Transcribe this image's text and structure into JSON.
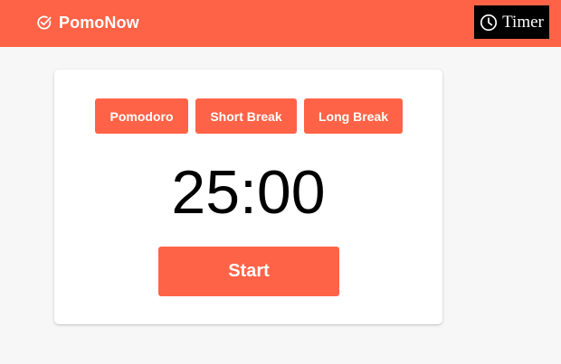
{
  "header": {
    "brand_icon": "check-circle-icon",
    "brand_name": "PomoNow",
    "timer_icon": "clock-icon",
    "timer_label": "Timer"
  },
  "colors": {
    "accent": "#ff6347",
    "page_background": "#f7f7f7",
    "card_background": "#ffffff",
    "timer_button_background": "#000000"
  },
  "timer": {
    "modes": [
      {
        "label": "Pomodoro"
      },
      {
        "label": "Short Break"
      },
      {
        "label": "Long Break"
      }
    ],
    "time": "25:00",
    "start_label": "Start"
  }
}
